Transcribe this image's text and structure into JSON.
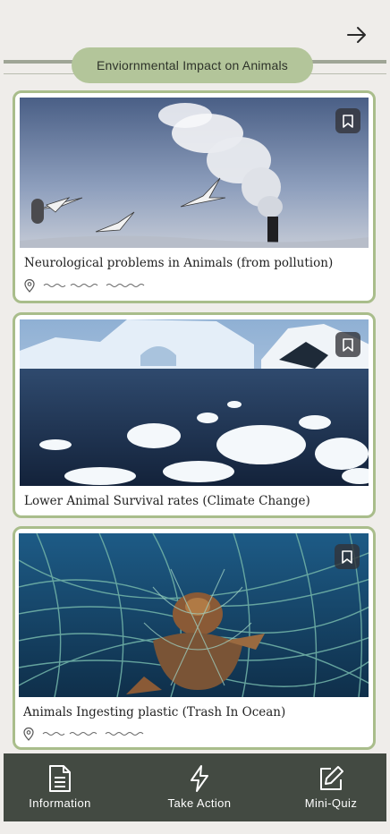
{
  "header": {
    "title": "Enviornmental Impact on Animals",
    "next_icon": "arrow-right-icon"
  },
  "cards": [
    {
      "title": "Neurological problems in Animals (from pollution)",
      "image": "swans flying past smokestack",
      "bookmark_icon": "bookmark-icon",
      "location_icon": "location-pin-icon"
    },
    {
      "title": "Lower Animal Survival rates (Climate Change)",
      "image": "melting sea ice and icebergs",
      "bookmark_icon": "bookmark-icon"
    },
    {
      "title": "Animals Ingesting plastic (Trash In Ocean)",
      "image": "sea turtle tangled in fishing net",
      "bookmark_icon": "bookmark-icon",
      "location_icon": "location-pin-icon"
    }
  ],
  "bottom_nav": {
    "items": [
      {
        "label": "Information",
        "icon": "document-icon"
      },
      {
        "label": "Take Action",
        "icon": "lightning-icon"
      },
      {
        "label": "Mini-Quiz",
        "icon": "edit-icon"
      }
    ]
  },
  "colors": {
    "background": "#efedea",
    "accent_green": "#b3c59a",
    "card_border": "#a9bd8b",
    "nav_background": "#434a42"
  }
}
